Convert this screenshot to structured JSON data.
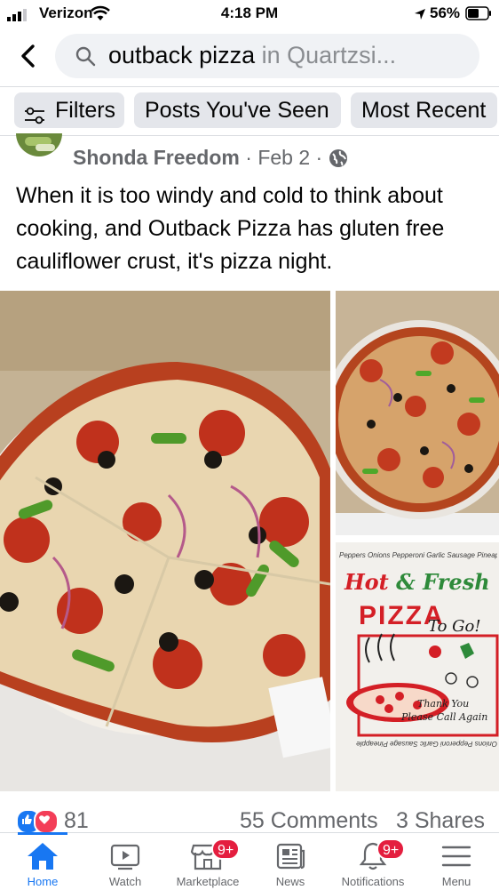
{
  "status_bar": {
    "carrier": "Verizon",
    "time": "4:18 PM",
    "battery": "56%"
  },
  "search": {
    "query": "outback pizza",
    "location_suffix": "in Quartzsi..."
  },
  "filters": [
    "Filters",
    "Posts You've Seen",
    "Most Recent"
  ],
  "post": {
    "author": "Shonda Freedom",
    "date": "Feb 2",
    "privacy_icon": "globe-icon",
    "text": "When it is too windy and cold to think about cooking, and Outback Pizza has gluten free cauliflower crust, it's pizza night.",
    "box_print": {
      "toppings_strip": "Peppers Onions Pepperoni Garlic Sausage Pineapple Mushrooms",
      "headline_hot": "Hot",
      "headline_amp": "&",
      "headline_fresh": "Fresh",
      "pizza": "PIZZA",
      "to_go": "To Go!",
      "thank_you": "Thank You",
      "please_call": "Please Call Again",
      "bottom_strip": "Onions Pepperoni Garlic Sausage Pineapple"
    }
  },
  "reactions": {
    "count": "81",
    "comments": "55 Comments",
    "shares": "3 Shares"
  },
  "tabbar": {
    "tabs": [
      {
        "label": "Home",
        "icon": "home-icon"
      },
      {
        "label": "Watch",
        "icon": "watch-icon"
      },
      {
        "label": "Marketplace",
        "icon": "marketplace-icon",
        "badge": "9+"
      },
      {
        "label": "News",
        "icon": "news-icon"
      },
      {
        "label": "Notifications",
        "icon": "bell-icon",
        "badge": "9+"
      },
      {
        "label": "Menu",
        "icon": "menu-icon"
      }
    ]
  },
  "colors": {
    "accent": "#1877f2",
    "badge": "#e41e3f",
    "secondary_text": "#65676b",
    "chip_bg": "#e4e6eb"
  }
}
